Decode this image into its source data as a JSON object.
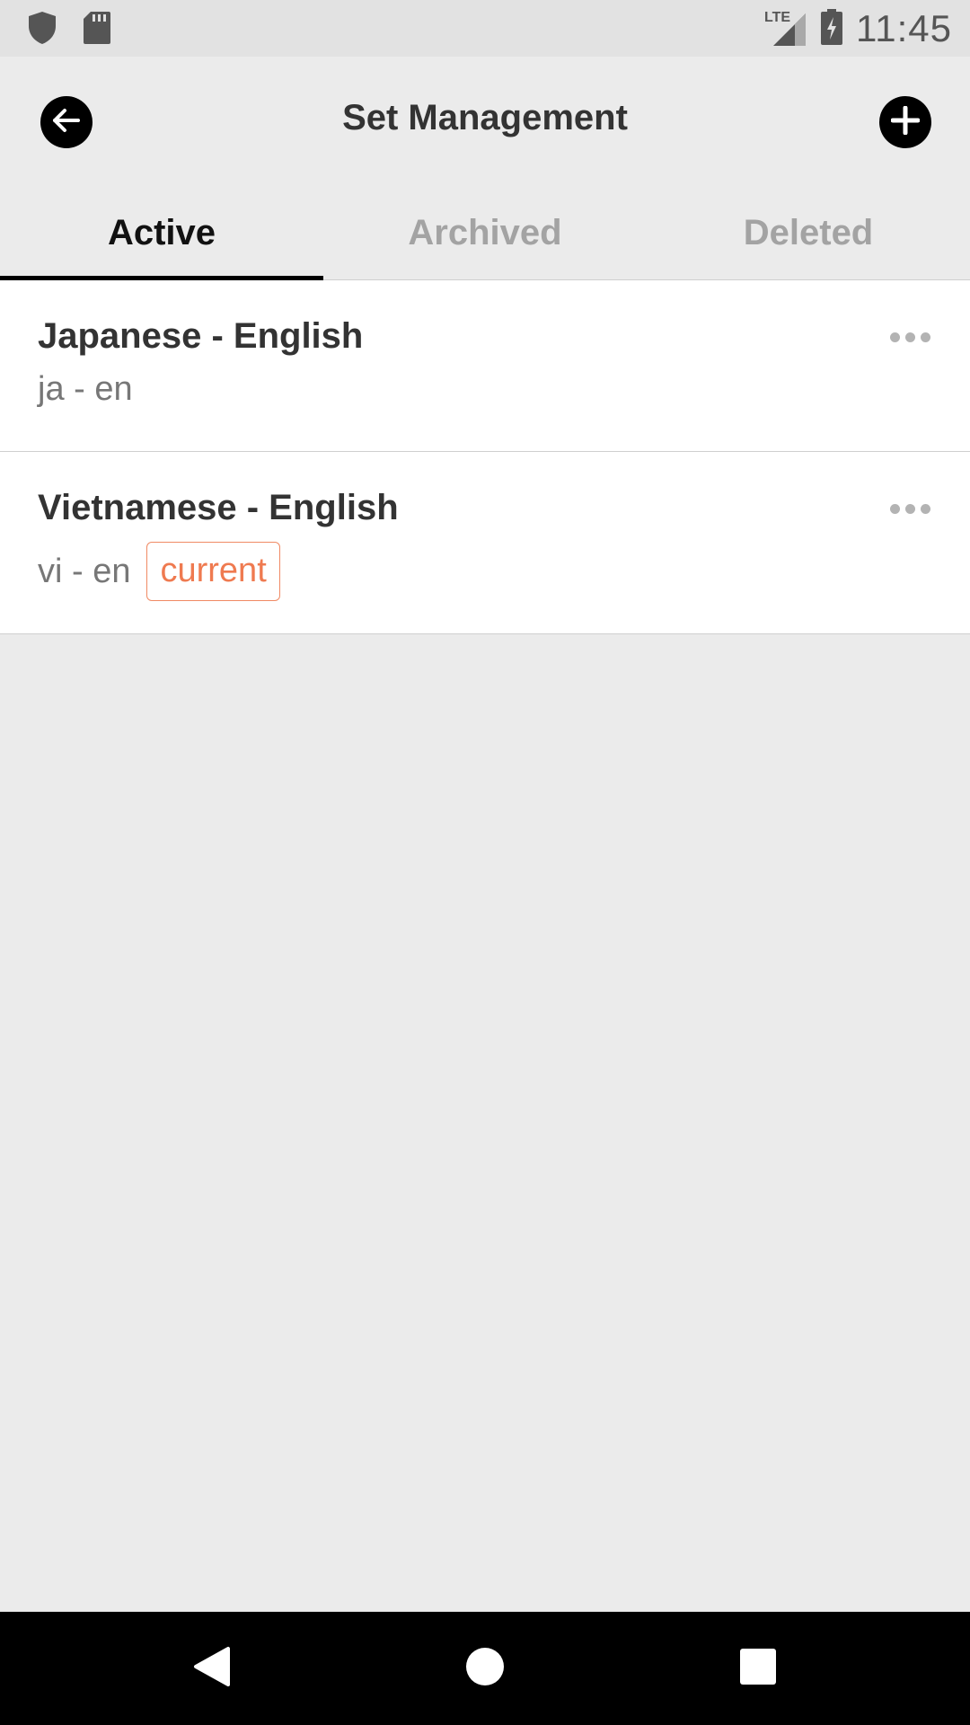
{
  "status_bar": {
    "network": "LTE",
    "time": "11:45"
  },
  "header": {
    "title": "Set Management",
    "back_icon": "arrow-left-icon",
    "add_icon": "plus-icon"
  },
  "tabs": [
    {
      "label": "Active",
      "active": true
    },
    {
      "label": "Archived",
      "active": false
    },
    {
      "label": "Deleted",
      "active": false
    }
  ],
  "sets": [
    {
      "title": "Japanese - English",
      "codes": "ja - en",
      "badge": null
    },
    {
      "title": "Vietnamese - English",
      "codes": "vi - en",
      "badge": "current"
    }
  ],
  "colors": {
    "accent": "#ef7a50",
    "background": "#ebebeb",
    "active_tab": "#111111",
    "inactive_tab": "#a3a3a3"
  }
}
